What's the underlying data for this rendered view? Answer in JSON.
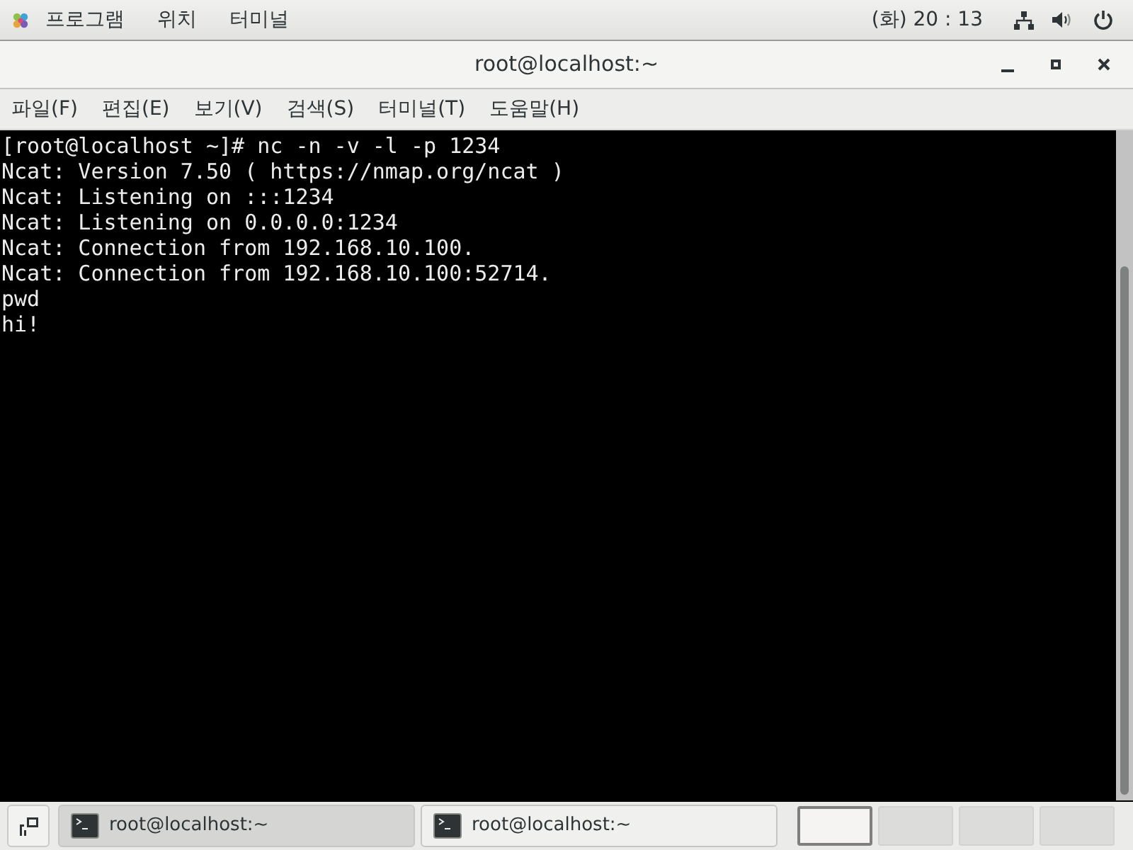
{
  "top_bar": {
    "menus": [
      "프로그램",
      "위치",
      "터미널"
    ],
    "clock": "(화) 20 : 13"
  },
  "window": {
    "title": "root@localhost:~"
  },
  "menu_bar": [
    "파일(F)",
    "편집(E)",
    "보기(V)",
    "검색(S)",
    "터미널(T)",
    "도움말(H)"
  ],
  "terminal": {
    "lines": [
      "[root@localhost ~]# nc -n -v -l -p 1234",
      "Ncat: Version 7.50 ( https://nmap.org/ncat )",
      "Ncat: Listening on :::1234",
      "Ncat: Listening on 0.0.0.0:1234",
      "Ncat: Connection from 192.168.10.100.",
      "Ncat: Connection from 192.168.10.100:52714.",
      "pwd",
      "hi!"
    ]
  },
  "taskbar": {
    "tasks": [
      {
        "label": "root@localhost:~",
        "selected": true
      },
      {
        "label": "root@localhost:~",
        "selected": false
      }
    ],
    "workspaces": [
      {
        "selected": true
      },
      {
        "selected": false
      },
      {
        "selected": false
      },
      {
        "selected": false
      }
    ]
  }
}
